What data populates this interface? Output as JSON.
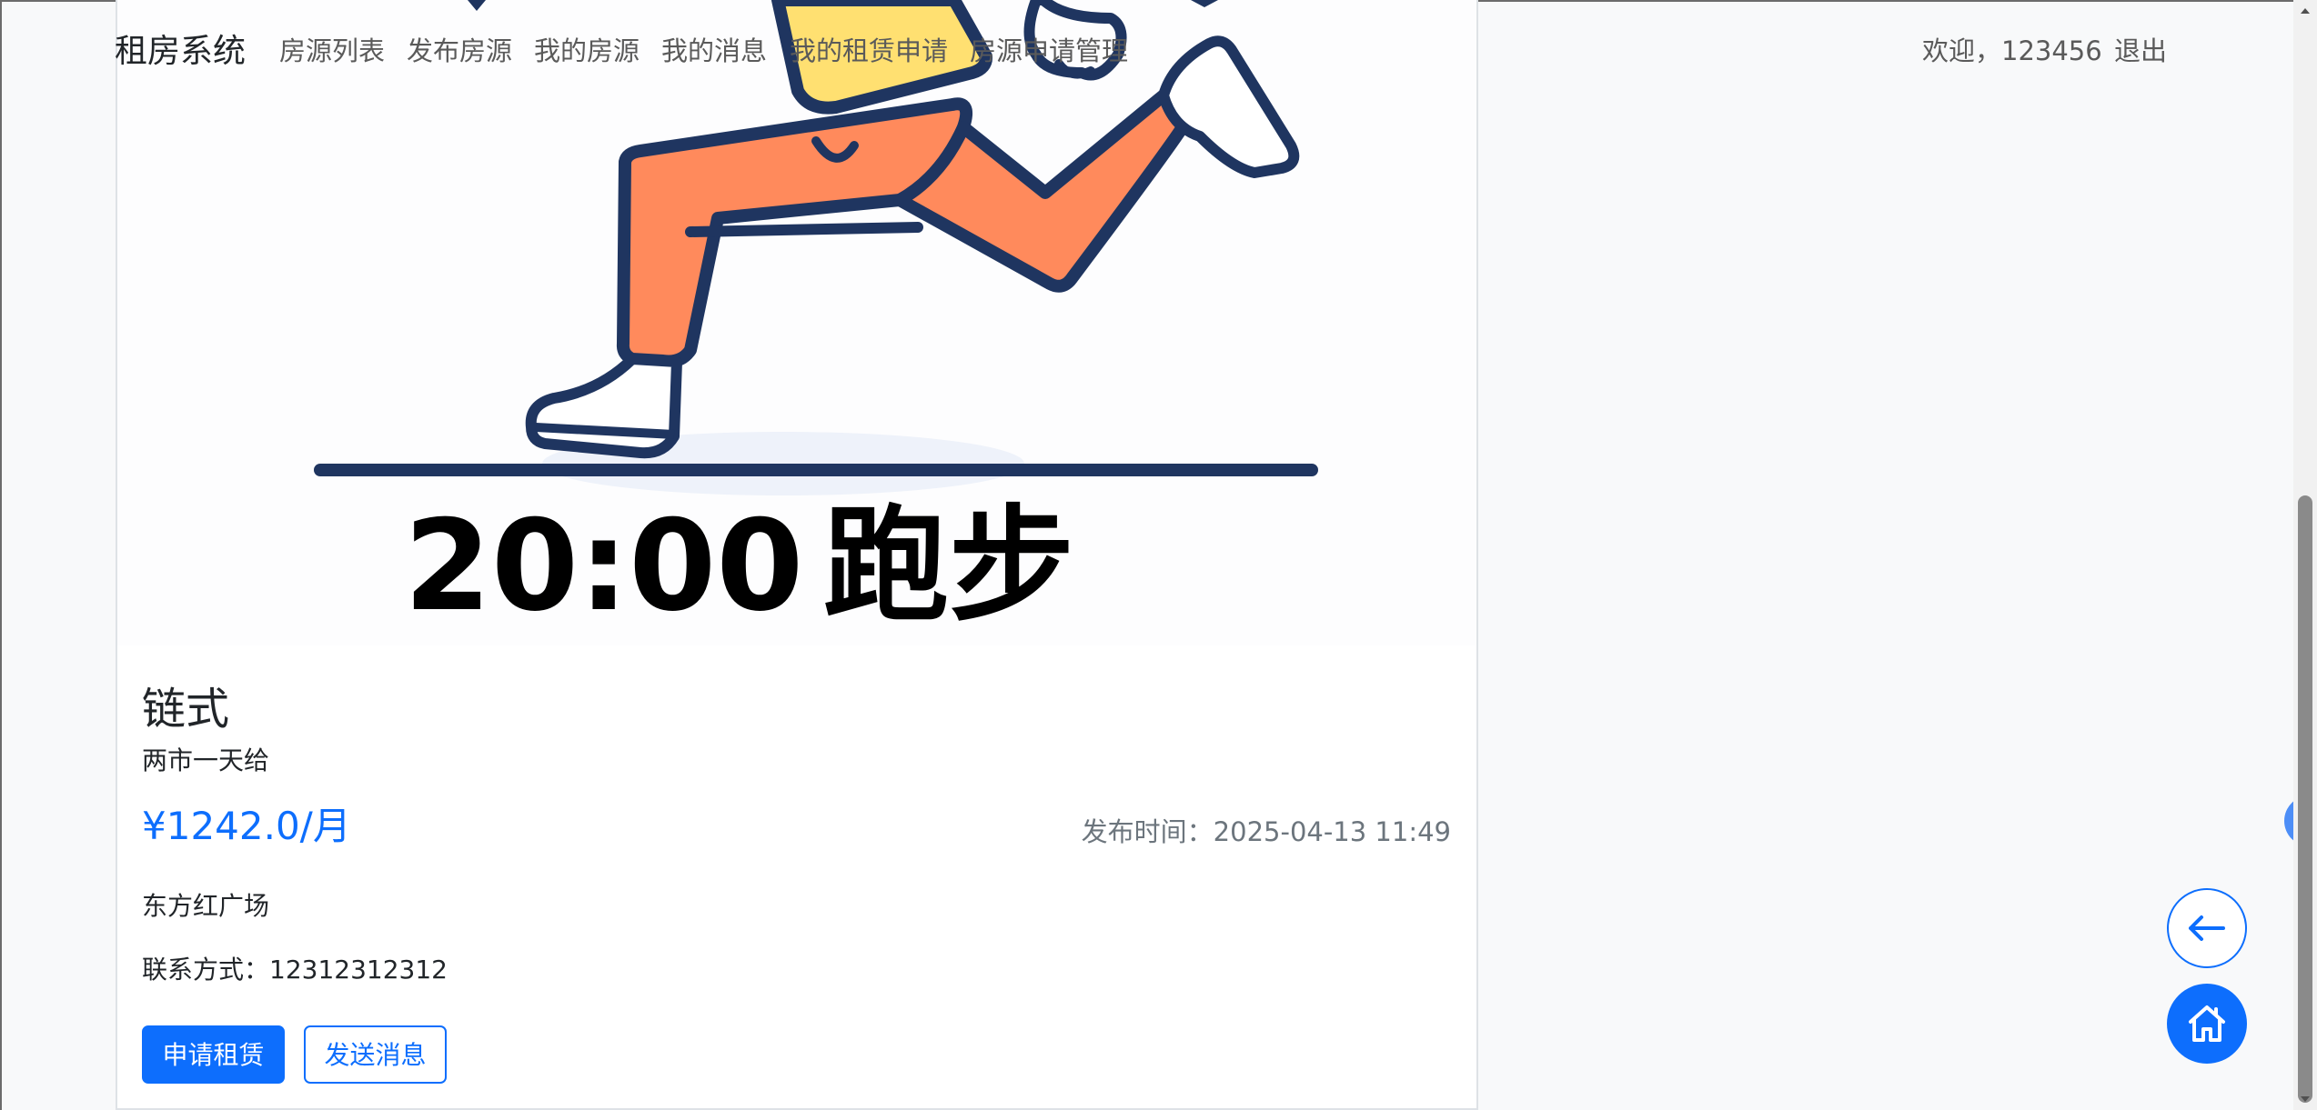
{
  "navbar": {
    "brand": "租房系统",
    "items": [
      "房源列表",
      "发布房源",
      "我的房源",
      "我的消息",
      "我的租赁申请",
      "房源申请管理"
    ],
    "welcome": "欢迎，123456",
    "logout": "退出"
  },
  "poster": {
    "time_text": "20:00",
    "activity_text": "跑步"
  },
  "house": {
    "title": "链式",
    "description": "两市一天给",
    "price": "¥1242.0/月",
    "publish_time": "发布时间：2025-04-13 11:49",
    "address": "东方红广场",
    "contact": "联系方式：12312312312"
  },
  "actions": {
    "apply_label": "申请租赁",
    "message_label": "发送消息"
  },
  "icons": {
    "back": "arrow-left-icon",
    "home": "home-icon",
    "side_tab": "chevron-left-icon"
  },
  "colors": {
    "primary": "#0d6efd",
    "pants": "#ff8a5c",
    "shirt": "#ffe071",
    "outline": "#1f3560"
  }
}
